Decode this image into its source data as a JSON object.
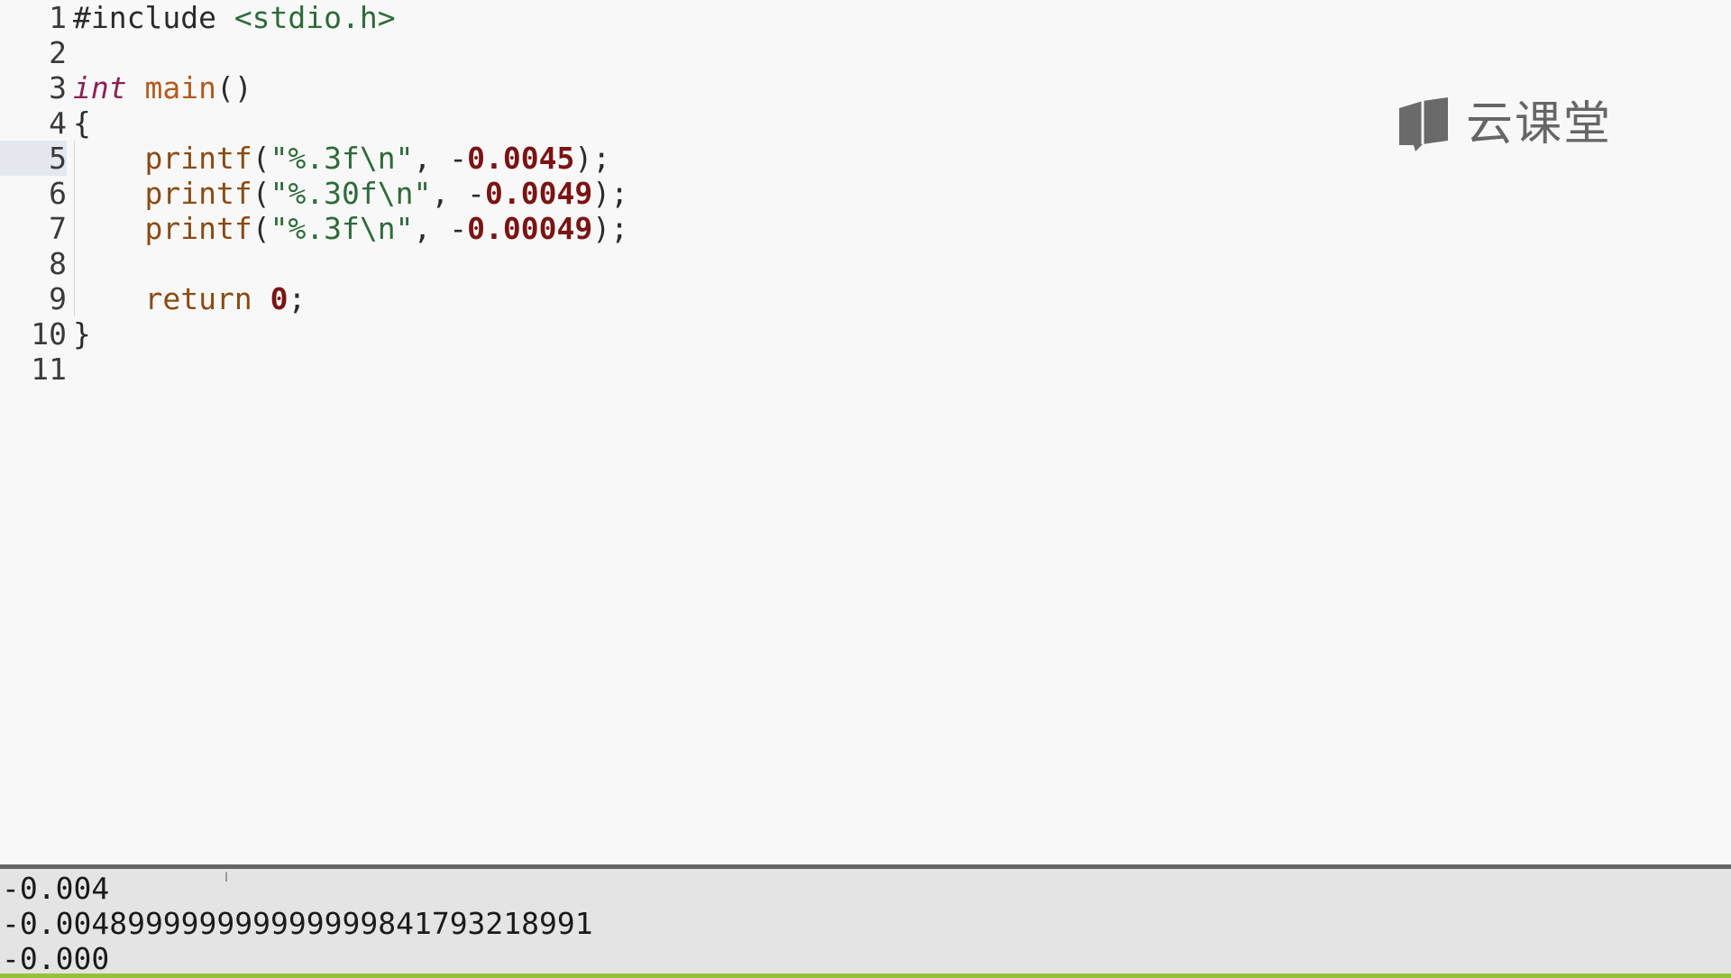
{
  "editor": {
    "lines": [
      {
        "num": "1",
        "tokens": [
          {
            "t": "#include ",
            "c": "kw-include"
          },
          {
            "t": "<stdio.h>",
            "c": "str-header"
          }
        ]
      },
      {
        "num": "2",
        "tokens": []
      },
      {
        "num": "3",
        "tokens": [
          {
            "t": "int",
            "c": "kw-type"
          },
          {
            "t": " ",
            "c": ""
          },
          {
            "t": "main",
            "c": "fn-name"
          },
          {
            "t": "()",
            "c": ""
          }
        ]
      },
      {
        "num": "4",
        "tokens": [
          {
            "t": "{",
            "c": ""
          }
        ]
      },
      {
        "num": "5",
        "tokens": [
          {
            "t": "    ",
            "c": ""
          },
          {
            "t": "printf",
            "c": "fn-call"
          },
          {
            "t": "(",
            "c": ""
          },
          {
            "t": "\"%.3f\\n\"",
            "c": "str"
          },
          {
            "t": ", -",
            "c": ""
          },
          {
            "t": "0.0045",
            "c": "num"
          },
          {
            "t": ");",
            "c": ""
          }
        ]
      },
      {
        "num": "6",
        "tokens": [
          {
            "t": "    ",
            "c": ""
          },
          {
            "t": "printf",
            "c": "fn-call"
          },
          {
            "t": "(",
            "c": ""
          },
          {
            "t": "\"%.30f\\n\"",
            "c": "str"
          },
          {
            "t": ", -",
            "c": ""
          },
          {
            "t": "0.0049",
            "c": "num"
          },
          {
            "t": ");",
            "c": ""
          }
        ]
      },
      {
        "num": "7",
        "tokens": [
          {
            "t": "    ",
            "c": ""
          },
          {
            "t": "printf",
            "c": "fn-call"
          },
          {
            "t": "(",
            "c": ""
          },
          {
            "t": "\"%.3f\\n\"",
            "c": "str"
          },
          {
            "t": ", -",
            "c": ""
          },
          {
            "t": "0.00049",
            "c": "num"
          },
          {
            "t": ");",
            "c": ""
          }
        ]
      },
      {
        "num": "8",
        "tokens": []
      },
      {
        "num": "9",
        "tokens": [
          {
            "t": "    ",
            "c": ""
          },
          {
            "t": "return",
            "c": "kw-return"
          },
          {
            "t": " ",
            "c": ""
          },
          {
            "t": "0",
            "c": "num"
          },
          {
            "t": ";",
            "c": ""
          }
        ]
      },
      {
        "num": "10",
        "tokens": [
          {
            "t": "}",
            "c": ""
          }
        ]
      },
      {
        "num": "11",
        "tokens": []
      }
    ],
    "active_line": "5"
  },
  "logo": {
    "brand_text": "云课堂",
    "icon": "book-chat-icon"
  },
  "console": {
    "output_lines": [
      "-0.004",
      "-0.004899999999999999841793218991",
      "-0.000"
    ]
  },
  "colors": {
    "background": "#f8f8f8",
    "console_background": "#e4e4e4",
    "accent_green": "#93c23a",
    "number": "#7a1414",
    "string": "#2e6b3a",
    "keyword_type": "#8a2157"
  }
}
